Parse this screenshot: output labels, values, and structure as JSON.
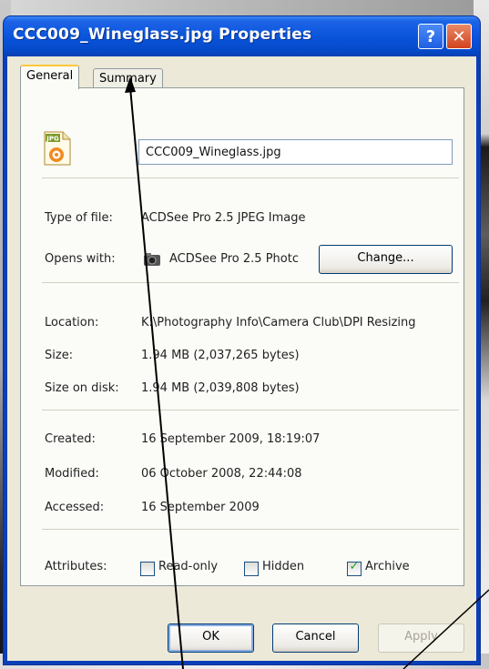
{
  "dialog": {
    "title": "CCC009_Wineglass.jpg Properties",
    "help_glyph": "?",
    "close_glyph": "✕"
  },
  "tabs": [
    {
      "label": "General",
      "active": true
    },
    {
      "label": "Summary",
      "active": false
    }
  ],
  "general": {
    "file_icon": "jpg-file-icon",
    "file_icon_badge": "JPG",
    "file_name": "CCC009_Wineglass.jpg",
    "type_label": "Type of file:",
    "type_value": "ACDSee Pro 2.5 JPEG Image",
    "opens_label": "Opens with:",
    "opens_value": "ACDSee Pro 2.5 Photc",
    "change_label": "Change...",
    "location_label": "Location:",
    "location_value": "K:\\Photography Info\\Camera Club\\DPI Resizing",
    "size_label": "Size:",
    "size_value": "1.94 MB (2,037,265 bytes)",
    "size_on_disk_label": "Size on disk:",
    "size_on_disk_value": "1.94 MB (2,039,808 bytes)",
    "created_label": "Created:",
    "created_value": "16 September 2009, 18:19:07",
    "modified_label": "Modified:",
    "modified_value": "06 October 2008, 22:44:08",
    "accessed_label": "Accessed:",
    "accessed_value": "16 September 2009",
    "attributes_label": "Attributes:",
    "attributes": [
      {
        "label": "Read-only",
        "checked": false
      },
      {
        "label": "Hidden",
        "checked": false
      },
      {
        "label": "Archive",
        "checked": true
      }
    ]
  },
  "buttons": {
    "ok": "OK",
    "cancel": "Cancel",
    "apply": "Apply"
  },
  "colors": {
    "titlebar": "#0a55dc",
    "dialog_bg": "#ece9d8",
    "annotation_line": "#000000"
  }
}
